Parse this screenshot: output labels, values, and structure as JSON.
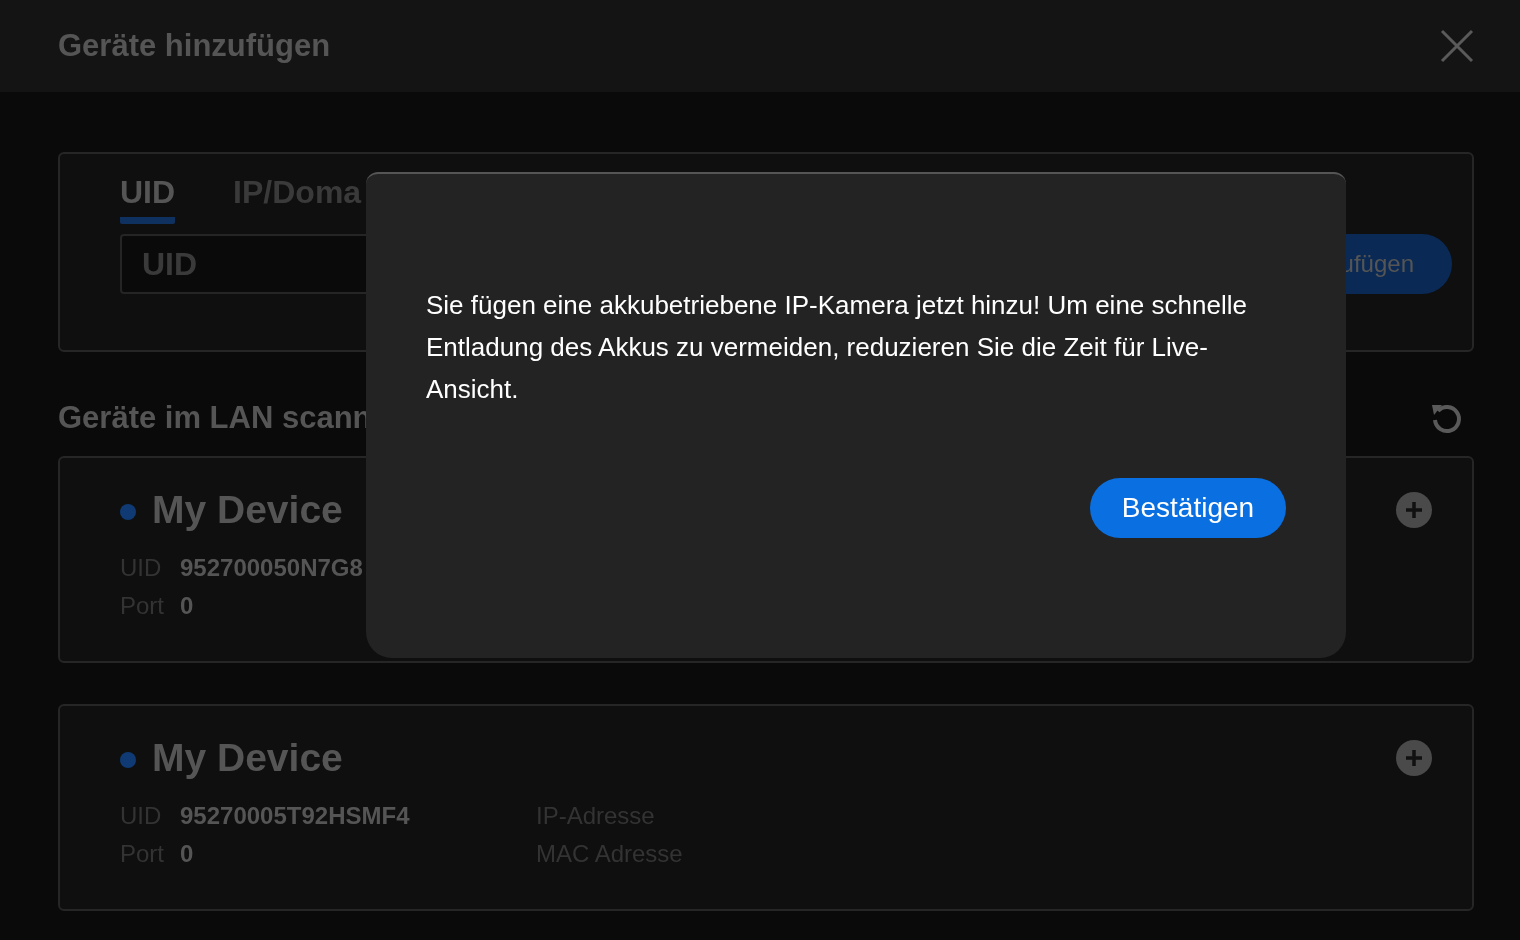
{
  "window": {
    "title": "Geräte hinzufügen"
  },
  "tabs": [
    {
      "label": "UID",
      "selected": true
    },
    {
      "label": "IP/Doma",
      "selected": false
    }
  ],
  "uid_field": {
    "placeholder": "UID"
  },
  "add_button": "ufügen",
  "lan_section": {
    "title": "Geräte im LAN scann"
  },
  "devices": [
    {
      "name": "My Device",
      "uid_label": "UID",
      "uid": "952700050N7G8",
      "port_label": "Port",
      "port": "0"
    },
    {
      "name": "My Device",
      "uid_label": "UID",
      "uid": "95270005T92HSMF4",
      "port_label": "Port",
      "port": "0",
      "ip_label": "IP-Adresse",
      "mac_label": "MAC Adresse"
    }
  ],
  "dialog": {
    "message": "Sie fügen eine akkubetriebene IP-Kamera jetzt hinzu! Um eine schnelle Entladung des Akkus zu vermeiden, reduzieren Sie die Zeit für Live-Ansicht.",
    "confirm": "Bestätigen"
  }
}
